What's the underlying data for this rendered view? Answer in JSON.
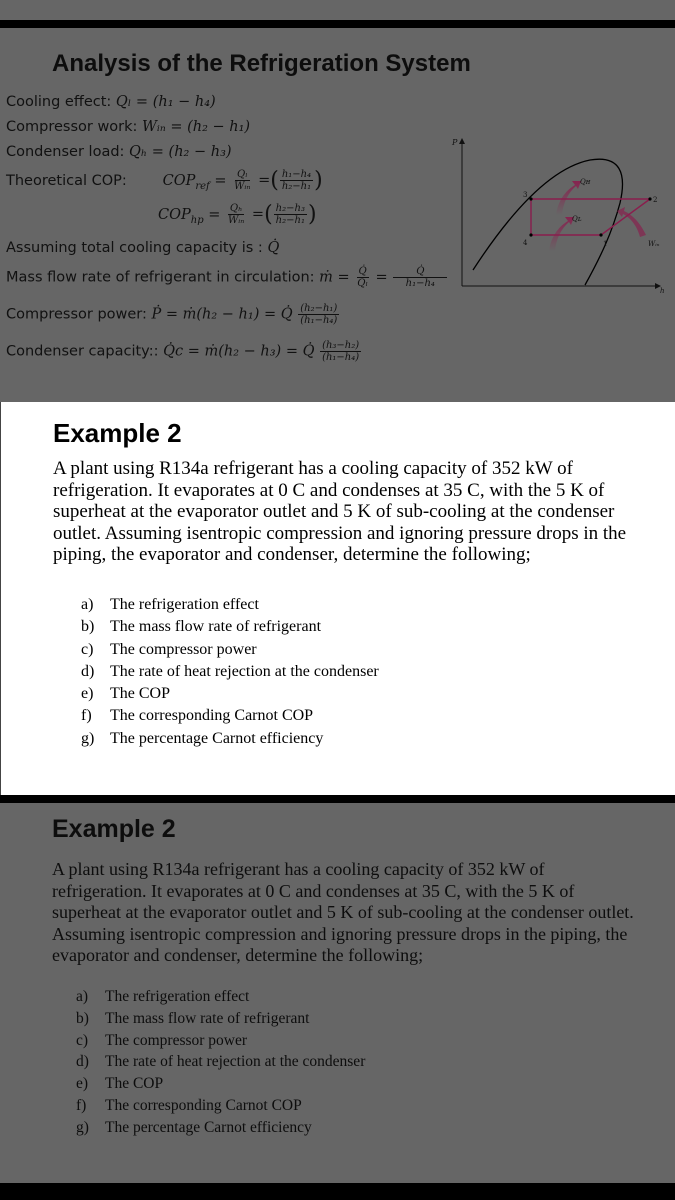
{
  "slide1": {
    "title": "Analysis of the Refrigeration System",
    "cooling_effect_label": "Cooling effect: ",
    "cooling_effect_expr": "Qₗ = (h₁ − h₄)",
    "compressor_work_label": "Compressor work: ",
    "compressor_work_expr": "Wᵢₙ = (h₂ − h₁)",
    "condenser_load_label": "Condenser load: ",
    "condenser_load_expr": "Qₕ = (h₂ − h₃)",
    "theoretical_cop_label": "Theoretical COP:",
    "cop_ref_lhs": "COP",
    "cop_ref_sub": "ref",
    "cop_ref_frac1_num": "Qₗ",
    "cop_ref_frac1_den": "Wᵢₙ",
    "cop_ref_frac2_num": "h₁−h₄",
    "cop_ref_frac2_den": "h₂−h₁",
    "cop_hp_lhs": "COP",
    "cop_hp_sub": "hp",
    "cop_hp_frac1_num": "Qₕ",
    "cop_hp_frac1_den": "Wᵢₙ",
    "cop_hp_frac2_num": "h₂−h₃",
    "cop_hp_frac2_den": "h₂−h₁",
    "assume_label": "Assuming total cooling capacity is : ",
    "assume_expr": "Q̇",
    "mass_flow_label": "Mass flow rate of refrigerant in circulation: ",
    "mass_flow_lhs": "ṁ =",
    "mass_flow_frac1_num": "Q̇",
    "mass_flow_frac1_den": "Qₗ",
    "mass_flow_frac2_num": "Q̇",
    "mass_flow_frac2_den": "h₁−h₄",
    "comp_power_label": "Compressor power: ",
    "comp_power_expr": "Ṗ = ṁ(h₂ − h₁) = Q̇",
    "comp_power_frac_num": "(h₂−h₁)",
    "comp_power_frac_den": "(h₁−h₄)",
    "cond_cap_label": "Condenser capacity:: ",
    "cond_cap_expr": "Q̇c = ṁ(h₂ − h₃) = Q̇",
    "cond_cap_frac_num": "(h₃−h₂)",
    "cond_cap_frac_den": "(h₁−h₄)",
    "diagram": {
      "axis_y": "P",
      "axis_x": "h",
      "point_1": "1",
      "point_2": "2",
      "point_3": "3",
      "point_4": "4",
      "qh": "Qʜ",
      "ql": "Qʟ",
      "win": "Wᵢₙ",
      "cycle_color": "#8a1d4d",
      "dome_color": "#000000"
    }
  },
  "example": {
    "title": "Example 2",
    "paragraph": "A plant using R134a refrigerant has a cooling capacity of 352 kW of refrigeration. It evaporates at 0 C and condenses at 35 C, with the 5 K of superheat at the evaporator outlet and 5 K of sub-cooling at the condenser outlet. Assuming isentropic compression and ignoring pressure drops in the piping, the evaporator and condenser, determine the following;",
    "items": [
      {
        "marker": "a)",
        "text": "The refrigeration effect"
      },
      {
        "marker": "b)",
        "text": "The mass flow rate of refrigerant"
      },
      {
        "marker": "c)",
        "text": "The compressor power"
      },
      {
        "marker": "d)",
        "text": "The rate of heat rejection at the condenser"
      },
      {
        "marker": "e)",
        "text": "The COP"
      },
      {
        "marker": "f)",
        "text": "The corresponding Carnot COP"
      },
      {
        "marker": "g)",
        "text": "The percentage Carnot efficiency"
      }
    ]
  }
}
